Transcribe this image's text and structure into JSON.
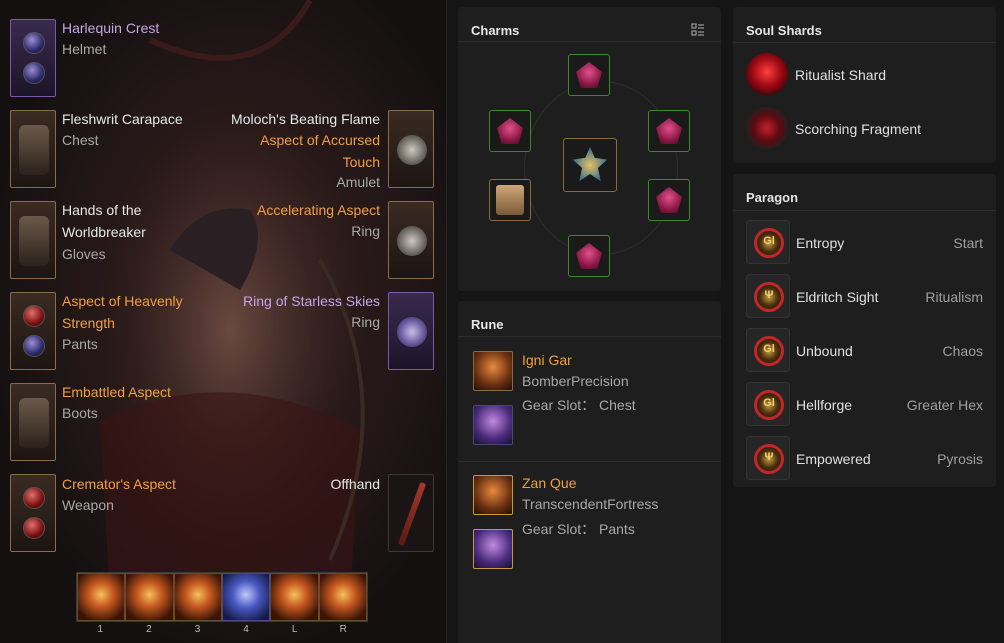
{
  "equipment": {
    "helmet": {
      "name": "Harlequin Crest",
      "type": "Helmet"
    },
    "chest": {
      "name": "Fleshwrit Carapace",
      "type": "Chest"
    },
    "gloves": {
      "name_line1": "Hands of the",
      "name_line2": "Worldbreaker",
      "type": "Gloves"
    },
    "pants": {
      "name_line1": "Aspect of Heavenly",
      "name_line2": "Strength",
      "type": "Pants"
    },
    "boots": {
      "name": "Embattled Aspect",
      "type": "Boots"
    },
    "weapon": {
      "name": "Cremator's Aspect",
      "type": "Weapon"
    },
    "amulet": {
      "name_line1": "Moloch's Beating Flame",
      "name_line2": "Aspect of Accursed",
      "name_line3": "Touch",
      "type": "Amulet"
    },
    "ring1": {
      "name": "Accelerating Aspect",
      "type": "Ring"
    },
    "ring2": {
      "name": "Ring of Starless Skies",
      "type": "Ring"
    },
    "offhand": {
      "name": "Offhand"
    }
  },
  "skills": {
    "keys": [
      "1",
      "2",
      "3",
      "4",
      "L",
      "R"
    ]
  },
  "charms": {
    "title": "Charms"
  },
  "rune": {
    "title": "Rune",
    "entries": [
      {
        "name": "Igni Gar",
        "desc": "BomberPrecision",
        "slot": "Gear Slot： Chest"
      },
      {
        "name": "Zan Que",
        "desc": "TranscendentFortress",
        "slot": "Gear Slot： Pants"
      }
    ]
  },
  "soul_shards": {
    "title": "Soul Shards",
    "items": [
      "Ritualist Shard",
      "Scorching Fragment"
    ]
  },
  "paragon": {
    "title": "Paragon",
    "items": [
      {
        "glyph": "Entropy",
        "board": "Start"
      },
      {
        "glyph": "Eldritch Sight",
        "board": "Ritualism"
      },
      {
        "glyph": "Unbound",
        "board": "Chaos"
      },
      {
        "glyph": "Hellforge",
        "board": "Greater Hex"
      },
      {
        "glyph": "Empowered",
        "board": "Pyrosis"
      }
    ]
  },
  "colors": {
    "legendary": "#f0a040",
    "unique": "#c4a6e6",
    "panel_bg": "#1e1e1e",
    "page_bg": "#151515"
  }
}
